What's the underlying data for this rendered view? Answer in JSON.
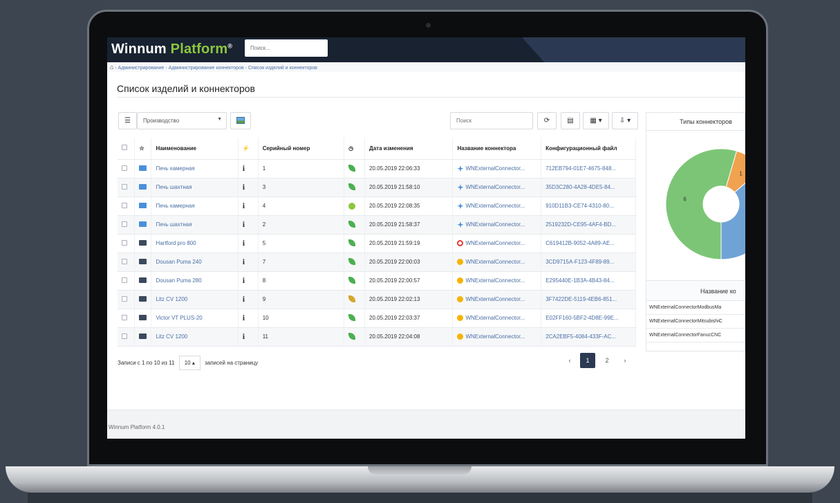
{
  "app": {
    "logo_main": "Winnum",
    "logo_accent": "Platform",
    "logo_mark": "®",
    "search_placeholder": "Поиск..."
  },
  "breadcrumb": [
    "Администрирование",
    "Администрирование коннекторов",
    "Список изделий и коннекторов"
  ],
  "page_title": "Список изделий и коннекторов",
  "toolbar": {
    "filter_value": "Производство",
    "search_placeholder": "Поиск",
    "columns_caret": "▾",
    "export_caret": "▾"
  },
  "table": {
    "headers": [
      "Наименование",
      "Серийный номер",
      "Дата изменения",
      "Название коннектора",
      "Конфигурационный файл"
    ],
    "rows": [
      {
        "name": "Печь камерная",
        "type": "furnace",
        "serial": "1",
        "status": "ok",
        "date": "20.05.2019 22:06:33",
        "conn_status": "connected",
        "connector": "WNExternalConnector...",
        "config": "712EB794-01E7-4675-848..."
      },
      {
        "name": "Печь шахтная",
        "type": "furnace",
        "serial": "3",
        "status": "ok",
        "date": "20.05.2019 21:58:10",
        "conn_status": "connected",
        "connector": "WNExternalConnector...",
        "config": "35D3C280-4A28-4DE5-84..."
      },
      {
        "name": "Печь камерная",
        "type": "furnace",
        "serial": "4",
        "status": "idle",
        "date": "20.05.2019 22:08:35",
        "conn_status": "connected",
        "connector": "WNExternalConnector...",
        "config": "910D11B3-CE74-4310-80..."
      },
      {
        "name": "Печь шахтная",
        "type": "furnace",
        "serial": "2",
        "status": "ok",
        "date": "20.05.2019 21:58:37",
        "conn_status": "connected",
        "connector": "WNExternalConnector...",
        "config": "2519232D-CE95-4AF4-BD..."
      },
      {
        "name": "Hartford pro 800",
        "type": "cnc",
        "serial": "5",
        "status": "ok",
        "date": "20.05.2019 21:59:19",
        "conn_status": "error",
        "connector": "WNExternalConnector...",
        "config": "C619412B-9052-4A89-AE..."
      },
      {
        "name": "Dousan Puma 240",
        "type": "cnc",
        "serial": "7",
        "status": "ok",
        "date": "20.05.2019 22:00:03",
        "conn_status": "fanuc",
        "connector": "WNExternalConnector...",
        "config": "3CD9715A-F123-4F89-89..."
      },
      {
        "name": "Dousan Puma 280",
        "type": "cnc",
        "serial": "8",
        "status": "ok",
        "date": "20.05.2019 22:00:57",
        "conn_status": "fanuc",
        "connector": "WNExternalConnector...",
        "config": "E295440E-1B3A-4B43-84..."
      },
      {
        "name": "Litz CV 1200",
        "type": "cnc",
        "serial": "9",
        "status": "warn",
        "date": "20.05.2019 22:02:13",
        "conn_status": "fanuc",
        "connector": "WNExternalConnector...",
        "config": "3F7422DE-5119-4EB6-851..."
      },
      {
        "name": "Victor VT PLUS-20",
        "type": "cnc",
        "serial": "10",
        "status": "ok",
        "date": "20.05.2019 22:03:37",
        "conn_status": "fanuc",
        "connector": "WNExternalConnector...",
        "config": "E02FF160-5BF2-4D8E-99E..."
      },
      {
        "name": "Litz CV 1200",
        "type": "cnc",
        "serial": "11",
        "status": "ok",
        "date": "20.05.2019 22:04:08",
        "conn_status": "fanuc",
        "connector": "WNExternalConnector...",
        "config": "2CA2EBF5-4084-433F-AC..."
      }
    ]
  },
  "pagination": {
    "records_info": "Записи с 1 по 10 из 11",
    "page_size": "10",
    "page_size_suffix": "записей на страницу",
    "prev": "‹",
    "pages": [
      "1",
      "2"
    ],
    "next": "›"
  },
  "side_panel": {
    "title": "Типы коннекторов",
    "subtable_header": "Название ко",
    "items": [
      "WNExternalConnectorModbusMa",
      "WNExternalConnectorMitsubishiC",
      "WNExternalConnectorFanucCNC"
    ]
  },
  "chart_data": {
    "type": "pie",
    "title": "Типы коннекторов",
    "categories": [
      "",
      "",
      ""
    ],
    "values": [
      6,
      1,
      4
    ],
    "colors": [
      "#7cc576",
      "#f0a24f",
      "#6fa3d6"
    ]
  },
  "footer": {
    "version": "Winnum Platform 4.0.1"
  },
  "colors": {
    "topbar": "#182231",
    "logo_accent": "#8dc63f",
    "link": "#4a6fa5",
    "active_page": "#2b3a52"
  }
}
